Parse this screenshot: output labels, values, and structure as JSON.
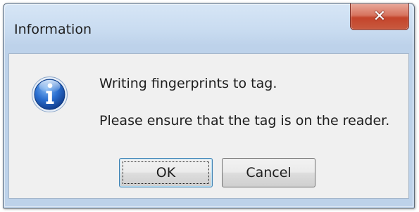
{
  "dialog": {
    "title": "Information",
    "close_icon": "close-icon",
    "icon": "information-icon",
    "message_line1": "Writing fingerprints to tag.",
    "message_line2": "Please ensure that the tag is on the reader.",
    "buttons": {
      "ok_label": "OK",
      "cancel_label": "Cancel"
    }
  },
  "colors": {
    "title_bar": "#c8dbf0",
    "close_button": "#c4442b",
    "client_background": "#f0f0f0",
    "info_icon_blue": "#1f5fbf"
  }
}
